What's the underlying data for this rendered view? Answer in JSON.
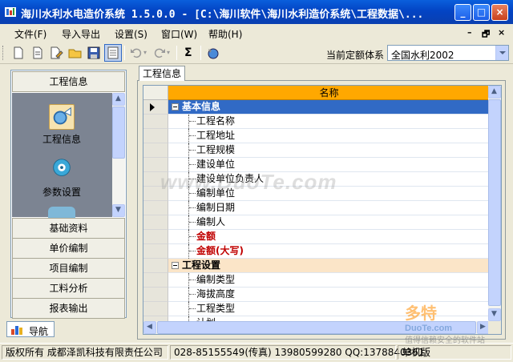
{
  "window": {
    "title": "海川水利水电造价系统 1.5.0.0 - [C:\\海川软件\\海川水利造价系统\\工程数据\\...",
    "controls": [
      "_",
      "□",
      "×"
    ]
  },
  "menu": {
    "items": [
      {
        "label": "文件(F)"
      },
      {
        "label": "导入导出"
      },
      {
        "label": "设置(S)"
      },
      {
        "label": "窗口(W)"
      },
      {
        "label": "帮助(H)"
      }
    ],
    "mdi_controls": [
      "–",
      "🗗",
      "×"
    ]
  },
  "toolbar": {
    "quota_label": "当前定额体系",
    "quota_value": "全国水利2002"
  },
  "nav": {
    "top_header": "工程信息",
    "tiles": [
      {
        "label": "工程信息",
        "icon": "project-info-icon"
      },
      {
        "label": "参数设置",
        "icon": "parameter-settings-icon"
      }
    ],
    "sections": [
      "基础资料",
      "单价编制",
      "项目编制",
      "工料分析",
      "报表输出"
    ],
    "tab_label": "导航"
  },
  "document": {
    "tab_label": "工程信息",
    "column_header": "名称",
    "rows": [
      {
        "type": "group",
        "text": "基本信息"
      },
      {
        "type": "item",
        "text": "工程名称"
      },
      {
        "type": "item",
        "text": "工程地址"
      },
      {
        "type": "item",
        "text": "工程规模"
      },
      {
        "type": "item",
        "text": "建设单位"
      },
      {
        "type": "item",
        "text": "建设单位负责人"
      },
      {
        "type": "item",
        "text": "编制单位"
      },
      {
        "type": "item",
        "text": "编制日期"
      },
      {
        "type": "item",
        "text": "编制人"
      },
      {
        "type": "item",
        "text": "金额",
        "highlight": true
      },
      {
        "type": "item",
        "text": "金额(大写)",
        "highlight": true
      },
      {
        "type": "group",
        "text": "工程设置"
      },
      {
        "type": "item",
        "text": "编制类型"
      },
      {
        "type": "item",
        "text": "海拔高度"
      },
      {
        "type": "item",
        "text": "工程类型"
      },
      {
        "type": "item",
        "text": "计划..."
      }
    ]
  },
  "status": {
    "copyright": "版权所有 成都泽凯科技有限责任公司",
    "contact": "028-85155549(传真) 13980599280 QQ:1378840361",
    "edition": "单机版"
  },
  "watermark": {
    "main": "www.DuoTe.com",
    "logo_big": "多特",
    "logo_small": "DuoTe.com",
    "logo_tagline": "值得信赖安全的软件站"
  },
  "colors": {
    "titlebar": "#0344c4",
    "header_orange": "#ffa800",
    "selected_group": "#316ac5",
    "group_peach": "#fbe5c8",
    "highlight_red": "#c00000"
  }
}
